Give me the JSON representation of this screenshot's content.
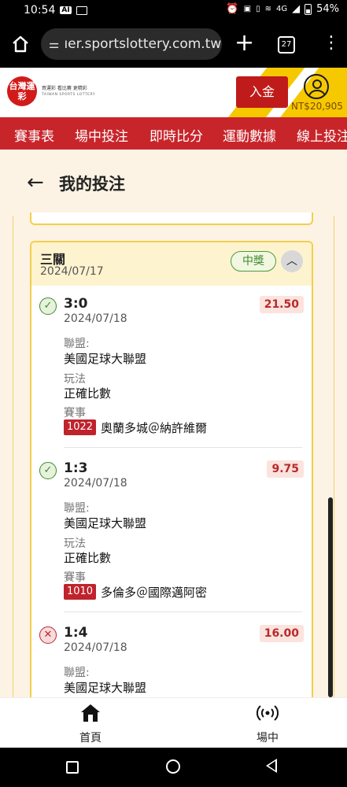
{
  "statusbar": {
    "time": "10:54",
    "ai_badge": "AI",
    "network": "4G",
    "battery": "54%",
    "icons": [
      "alarm-icon",
      "nfc-icon",
      "vibrate-icon",
      "hotspot-icon",
      "signal-icon",
      "battery-icon"
    ]
  },
  "browser": {
    "url": "ıer.sportslottery.com.tw",
    "tab_count": "27"
  },
  "site": {
    "logo_text": "台灣運彩",
    "slogan": "買運彩 看比賽 更精彩",
    "slogan_en": "TAIWAN SPORTS LOTTERY",
    "deposit_label": "入金",
    "balance": "NT$20,905"
  },
  "nav": {
    "items": [
      "賽事表",
      "場中投注",
      "即時比分",
      "運動數據",
      "線上投注"
    ]
  },
  "page": {
    "title": "我的投注"
  },
  "ticket": {
    "type": "三關",
    "date": "2024/07/17",
    "status": "中獎",
    "bets": [
      {
        "result": "win",
        "score": "3:0",
        "date": "2024/07/18",
        "odds": "21.50",
        "league_label": "聯盟:",
        "league": "美國足球大聯盟",
        "play_label": "玩法",
        "play": "正確比數",
        "event_label": "賽事",
        "event_number": "1022",
        "event": "奧蘭多城＠納許維爾"
      },
      {
        "result": "win",
        "score": "1:3",
        "date": "2024/07/18",
        "odds": "9.75",
        "league_label": "聯盟:",
        "league": "美國足球大聯盟",
        "play_label": "玩法",
        "play": "正確比數",
        "event_label": "賽事",
        "event_number": "1010",
        "event": "多倫多＠國際邁阿密"
      },
      {
        "result": "lose",
        "score": "1:4",
        "date": "2024/07/18",
        "odds": "16.00",
        "league_label": "聯盟:",
        "league": "美國足球大聯盟"
      }
    ]
  },
  "bottomnav": {
    "home_label": "首頁",
    "live_label": "場中"
  },
  "colors": {
    "brand_red": "#c8252b",
    "brand_yellow": "#f6c800",
    "win_green": "#3d8a2e",
    "lose_red": "#c0232c"
  }
}
